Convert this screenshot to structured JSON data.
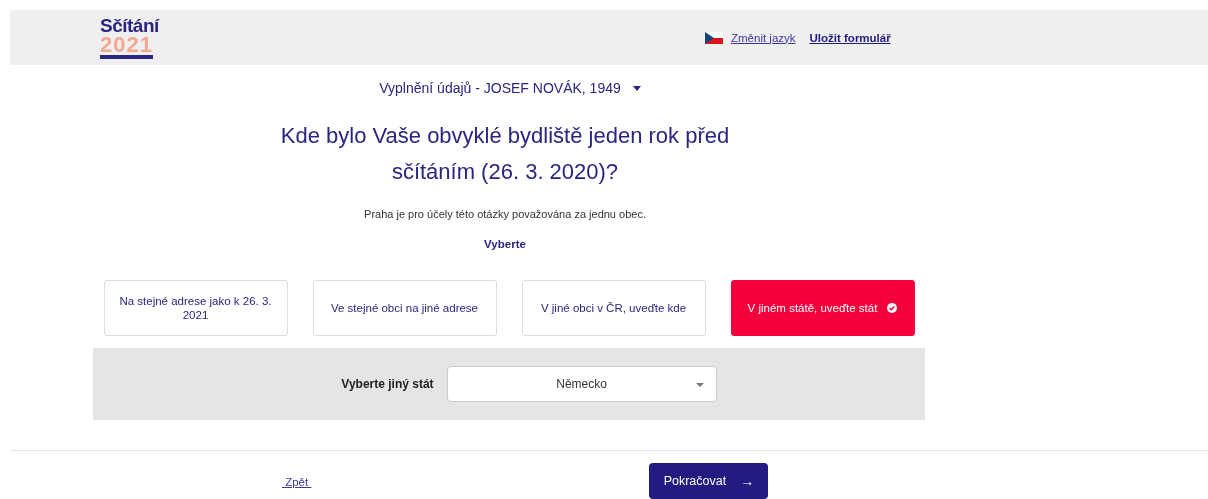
{
  "header": {
    "logo_title": "Sčítání",
    "logo_year": "2021",
    "language_link": "Změnit jazyk",
    "save_link": "Uložit formulář"
  },
  "person_selector": {
    "label": "Vyplnění údajů - JOSEF NOVÁK, 1949"
  },
  "question": "Kde bylo Vaše obvyklé bydliště jeden rok před sčítáním (26. 3. 2020)?",
  "note": "Praha je pro účely této otázky považována za jednu obec.",
  "prompt": "Vyberte",
  "options": [
    {
      "label": "Na stejné adrese jako k 26. 3. 2021",
      "selected": false
    },
    {
      "label": "Ve stejné obci na jiné adrese",
      "selected": false
    },
    {
      "label": "V jiné obci v ČR, uveďte kde",
      "selected": false
    },
    {
      "label": "V jiném státě, uveďte stát",
      "selected": true
    }
  ],
  "country_select": {
    "label": "Vyberte jiný stát",
    "value": "Německo"
  },
  "footer": {
    "back_link": "Zpět",
    "continue_button": "Pokračovat",
    "continue_arrow": "→"
  }
}
